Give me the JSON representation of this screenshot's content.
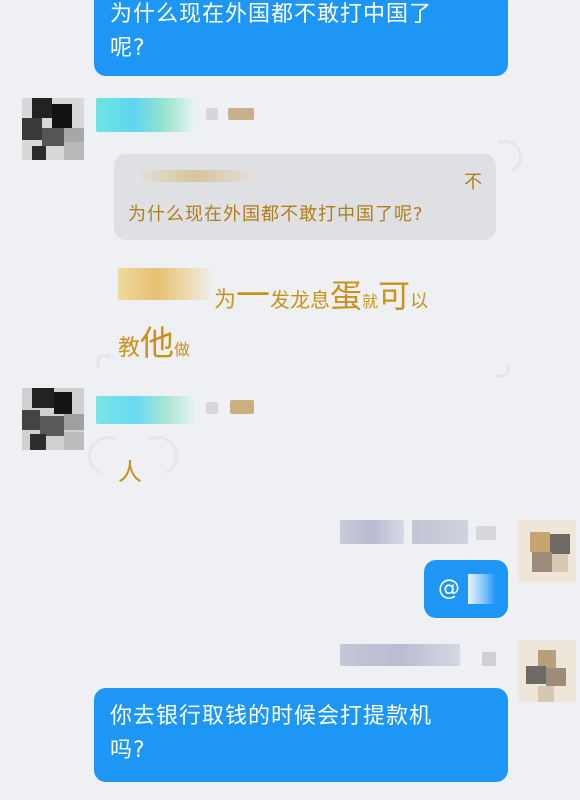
{
  "messages": {
    "top_outgoing": {
      "line1": "为什么现在外国都不敢打中国了",
      "line2": "呢?"
    },
    "incoming_1": {
      "quote_text": "为什么现在外国都不敢打中国了呢?",
      "quote_corner": "不",
      "reply": {
        "t1": "为",
        "t2": "一",
        "t3": "发龙息",
        "t4": "蛋",
        "t5": "就",
        "t6": "可",
        "t7": "以",
        "t8": "教",
        "t9": "他",
        "t10": "做"
      }
    },
    "incoming_2": {
      "text": "人"
    },
    "outgoing_mention": {
      "text": "@"
    },
    "bottom_outgoing": {
      "line1": "你去银行取钱的时候会打提款机",
      "line2": "吗?"
    }
  },
  "colors": {
    "outgoing_bubble": "#1e96f6",
    "background": "#eef0f4",
    "quote_box": "#dfe0e4",
    "gold_text": "#c9921b"
  }
}
